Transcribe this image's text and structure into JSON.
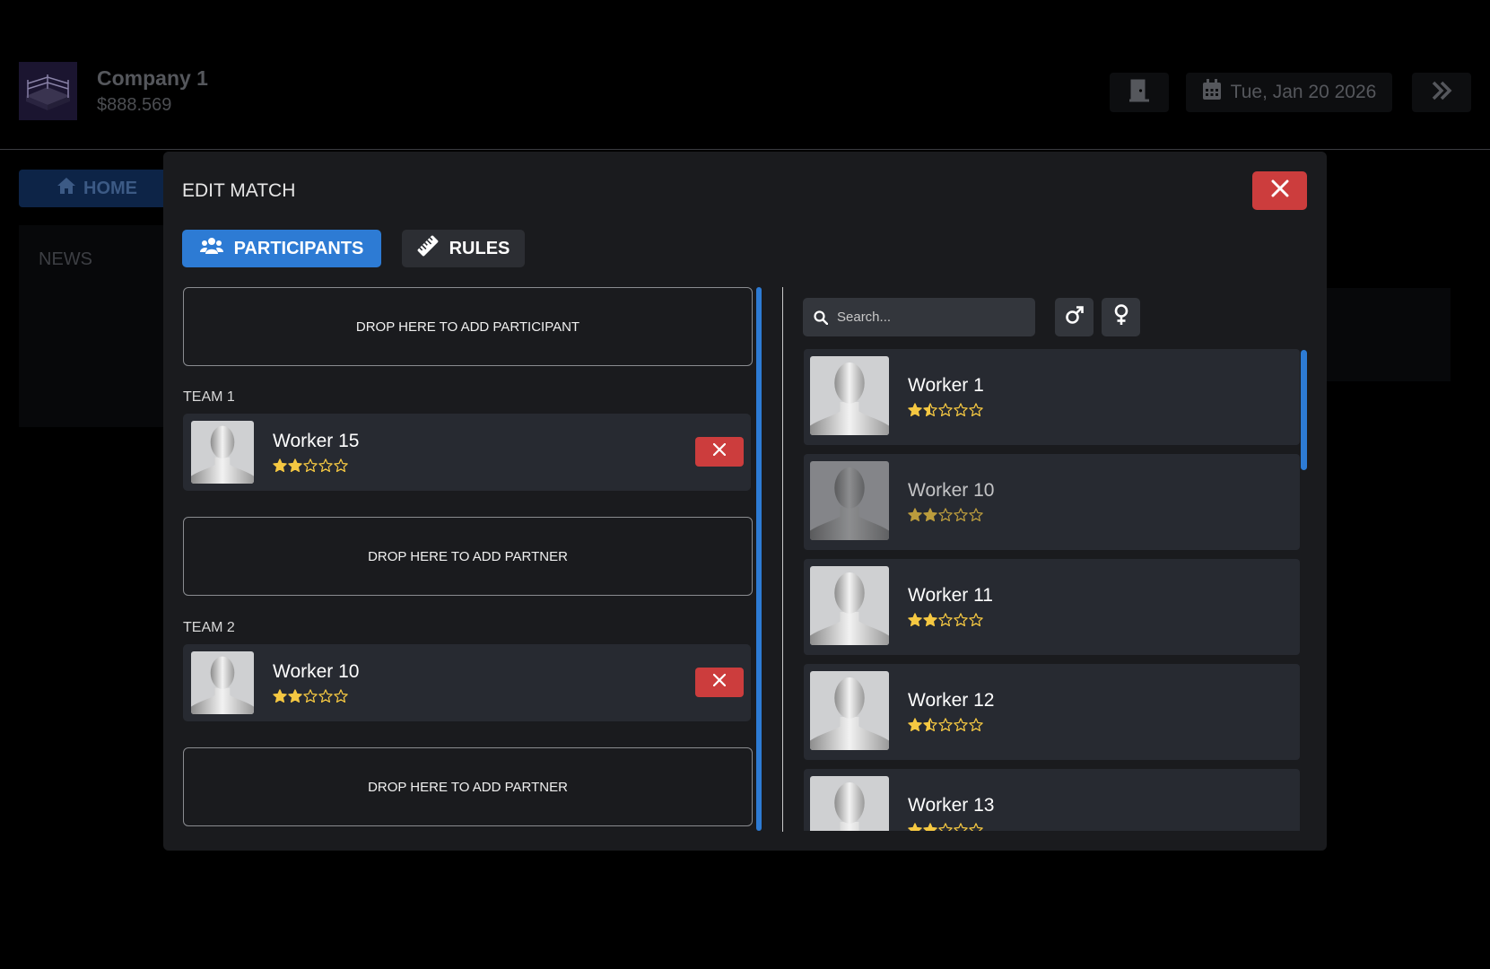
{
  "header": {
    "company_name": "Company 1",
    "company_money": "$888.569",
    "date": "Tue, Jan 20 2026",
    "exit_icon": "door-icon",
    "next_icon": "double-chevron-right-icon"
  },
  "nav": {
    "home_label": "HOME"
  },
  "news": {
    "label": "NEWS"
  },
  "modal": {
    "title": "EDIT MATCH",
    "tabs": [
      {
        "label": "PARTICIPANTS",
        "icon": "users-icon",
        "active": true
      },
      {
        "label": "RULES",
        "icon": "ruler-icon",
        "active": false
      }
    ],
    "participants": {
      "drop_participant": "DROP HERE TO ADD PARTICIPANT",
      "drop_partner": "DROP HERE TO ADD PARTNER",
      "teams": [
        {
          "label": "TEAM 1",
          "members": [
            {
              "name": "Worker 15",
              "rating": 2
            }
          ]
        },
        {
          "label": "TEAM 2",
          "members": [
            {
              "name": "Worker 10",
              "rating": 2
            }
          ]
        }
      ]
    },
    "search": {
      "placeholder": "Search..."
    },
    "roster": [
      {
        "name": "Worker 1",
        "rating": 1.5
      },
      {
        "name": "Worker 10",
        "rating": 2,
        "dimmed": true
      },
      {
        "name": "Worker 11",
        "rating": 2
      },
      {
        "name": "Worker 12",
        "rating": 1.5
      },
      {
        "name": "Worker 13",
        "rating": 2
      }
    ]
  },
  "colors": {
    "accent": "#2d7bd4",
    "danger": "#cc3d3d",
    "star": "#f5c842",
    "card": "#272a31",
    "modal": "#1a1b1e"
  }
}
